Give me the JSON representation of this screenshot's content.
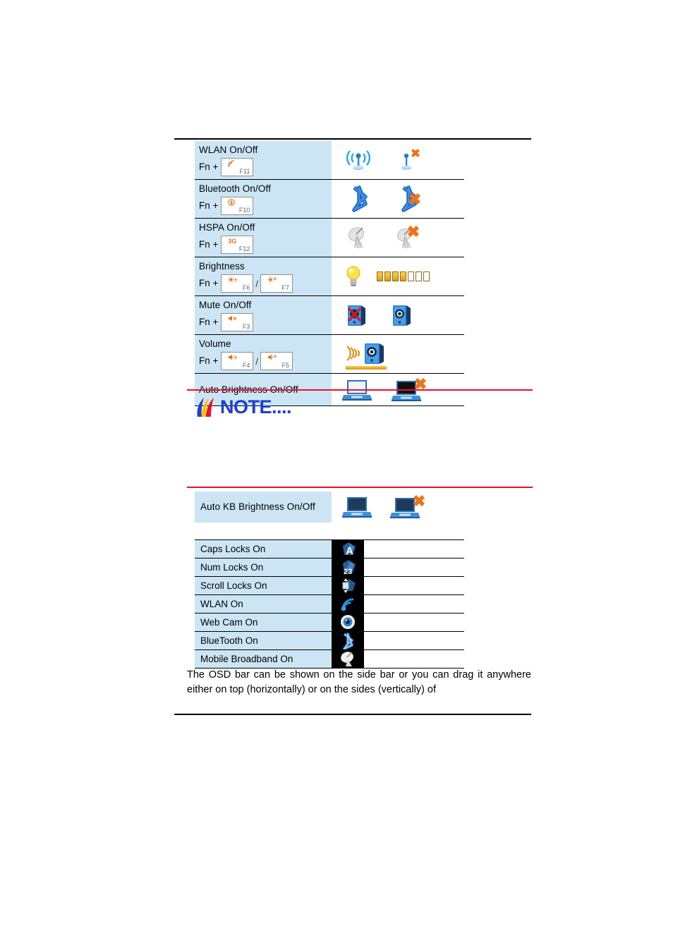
{
  "fn_table": {
    "rows": [
      {
        "title": "WLAN On/Off",
        "prefix": "Fn +",
        "keys": [
          {
            "glyph": "signal",
            "label": "F11"
          }
        ],
        "icons": [
          "wlan-on-icon",
          "wlan-off-icon"
        ]
      },
      {
        "title": "Bluetooth On/Off",
        "prefix": "Fn +",
        "keys": [
          {
            "glyph": "bluetooth",
            "label": "F10"
          }
        ],
        "icons": [
          "bluetooth-on-icon",
          "bluetooth-off-icon"
        ]
      },
      {
        "title": "HSPA On/Off",
        "prefix": "Fn +",
        "keys": [
          {
            "glyph": "3G",
            "label": "F12"
          }
        ],
        "icons": [
          "hspa-on-icon",
          "hspa-off-icon"
        ]
      },
      {
        "title": "Brightness",
        "prefix": "Fn +",
        "keys": [
          {
            "glyph": "sun-up",
            "label": "F6"
          },
          {
            "glyph": "sun-down",
            "label": "F7"
          }
        ],
        "icons": [
          "lightbulb-icon",
          "brightness-bar-icon"
        ]
      },
      {
        "title": "Mute On/Off",
        "prefix": "Fn +",
        "keys": [
          {
            "glyph": "speaker-mute",
            "label": "F3"
          }
        ],
        "icons": [
          "speaker-muted-icon",
          "speaker-icon"
        ]
      },
      {
        "title": "Volume",
        "prefix": "Fn +",
        "keys": [
          {
            "glyph": "volume-up",
            "label": "F4"
          },
          {
            "glyph": "volume-down",
            "label": "F5"
          }
        ],
        "icons": [
          "speaker-waves-icon",
          "volume-bar-icon"
        ]
      },
      {
        "title": "Auto Brightness On/Off",
        "prefix": "",
        "keys": [],
        "icons": [
          "laptop-bright-icon",
          "laptop-off-icon"
        ]
      }
    ],
    "key_separator": "/"
  },
  "note": {
    "label": "NOTE....",
    "logo": "note-flame-logo"
  },
  "kb_table": {
    "rows": [
      {
        "title": "Auto KB Brightness On/Off",
        "icons": [
          "laptop-kb-on-icon",
          "laptop-kb-off-icon"
        ]
      }
    ]
  },
  "osd_table": {
    "rows": [
      {
        "label": "Caps Locks On",
        "icon": "caps-lock-osd-icon"
      },
      {
        "label": "Num Locks On",
        "icon": "num-lock-osd-icon"
      },
      {
        "label": "Scroll Locks On",
        "icon": "scroll-lock-osd-icon"
      },
      {
        "label": "WLAN On",
        "icon": "wlan-osd-icon"
      },
      {
        "label": "Web Cam On",
        "icon": "webcam-osd-icon"
      },
      {
        "label": "BlueTooth On",
        "icon": "bluetooth-osd-icon"
      },
      {
        "label": "Mobile Broadband On",
        "icon": "mobile-broadband-osd-icon"
      }
    ]
  },
  "paragraph": {
    "text": "The OSD bar can be shown on the side bar or you can drag it anywhere either on top (horizontally) or on the sides (vertically) of"
  },
  "colors": {
    "cell_fill": "#cce5f5",
    "rule": "#000000",
    "accent_red": "#e8112d",
    "key_glyph": "#e2711d",
    "note_blue": "#1b3fd4"
  },
  "brightness_indicator": {
    "segments": 7,
    "filled": 4
  }
}
